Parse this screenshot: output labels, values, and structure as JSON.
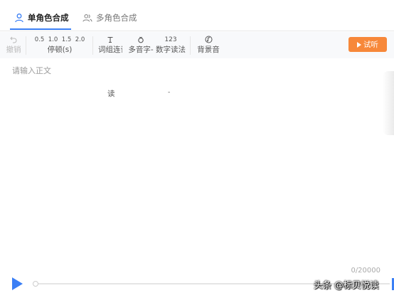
{
  "tabs": {
    "single": "单角色合成",
    "multi": "多角色合成"
  },
  "toolbar": {
    "undo": {
      "icon": "undo-icon",
      "label": "撤销"
    },
    "pause": {
      "values": [
        "0.5",
        "1.0",
        "1.5",
        "2.0"
      ],
      "label": "停顿(s)"
    },
    "word_group": {
      "icon": "text-cursor-icon",
      "label": "词组连读"
    },
    "polyphone": {
      "icon": "polyphone-icon",
      "label": "多音字",
      "suffix": "-"
    },
    "number_read": {
      "top": "123",
      "label": "数字读法",
      "suffix": "-"
    },
    "bgm": {
      "icon": "music-icon",
      "label": "背景音"
    },
    "try_label": "试听"
  },
  "editor": {
    "placeholder": "请输入正文",
    "counter": "0/20000"
  },
  "player": {
    "progress": 0
  },
  "watermark": "头条 @标贝悦读",
  "colors": {
    "accent": "#3b7ff5",
    "try_button": "#f7883a"
  }
}
